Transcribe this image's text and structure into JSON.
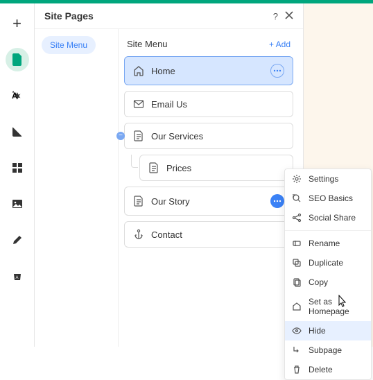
{
  "panel": {
    "title": "Site Pages"
  },
  "sidemenu": {
    "label": "Site Menu"
  },
  "main": {
    "heading": "Site Menu",
    "add_label": "+ Add"
  },
  "pages": {
    "home": "Home",
    "email_us": "Email Us",
    "our_services": "Our Services",
    "prices": "Prices",
    "our_story": "Our Story",
    "contact": "Contact"
  },
  "ctx": {
    "settings": "Settings",
    "seo": "SEO Basics",
    "social": "Social Share",
    "rename": "Rename",
    "duplicate": "Duplicate",
    "copy": "Copy",
    "homepage": "Set as Homepage",
    "hide": "Hide",
    "subpage": "Subpage",
    "delete": "Delete"
  }
}
